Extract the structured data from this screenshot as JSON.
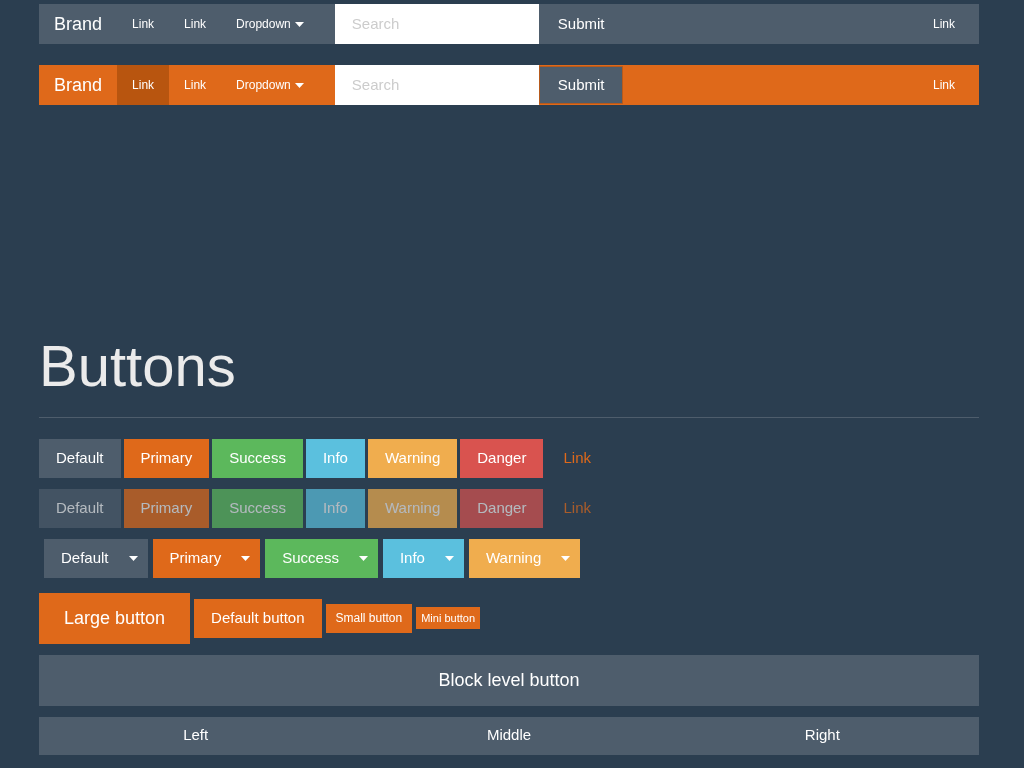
{
  "navbars": [
    {
      "kind": "default",
      "brand": "Brand",
      "links": [
        {
          "label": "Link",
          "kind": "link"
        },
        {
          "label": "Link",
          "kind": "link"
        },
        {
          "label": "Dropdown",
          "kind": "dropdown"
        }
      ],
      "search": {
        "placeholder": "Search"
      },
      "submit": "Submit",
      "right_link": "Link"
    },
    {
      "kind": "inverse",
      "brand": "Brand",
      "links": [
        {
          "label": "Link",
          "selected": true,
          "kind": "link"
        },
        {
          "label": "Link",
          "selected": false,
          "kind": "link"
        },
        {
          "label": "Dropdown",
          "selected": false,
          "kind": "dropdown"
        }
      ],
      "search": {
        "placeholder": "Search"
      },
      "submit": "Submit",
      "right_link": "Link"
    }
  ],
  "heading": "Buttons",
  "button_rows": [
    {
      "disabled": false,
      "buttons": [
        {
          "label": "Default",
          "kind": "default"
        },
        {
          "label": "Primary",
          "kind": "primary"
        },
        {
          "label": "Success",
          "kind": "success"
        },
        {
          "label": "Info",
          "kind": "info"
        },
        {
          "label": "Warning",
          "kind": "warning"
        },
        {
          "label": "Danger",
          "kind": "danger"
        },
        {
          "label": "Link",
          "kind": "link"
        }
      ]
    },
    {
      "disabled": true,
      "buttons": [
        {
          "label": "Default",
          "kind": "default"
        },
        {
          "label": "Primary",
          "kind": "primary"
        },
        {
          "label": "Success",
          "kind": "success"
        },
        {
          "label": "Info",
          "kind": "info"
        },
        {
          "label": "Warning",
          "kind": "warning"
        },
        {
          "label": "Danger",
          "kind": "danger"
        },
        {
          "label": "Link",
          "kind": "link"
        }
      ]
    }
  ],
  "split_buttons": [
    {
      "label": "Default",
      "kind": "default"
    },
    {
      "label": "Primary",
      "kind": "primary"
    },
    {
      "label": "Success",
      "kind": "success"
    },
    {
      "label": "Info",
      "kind": "info"
    },
    {
      "label": "Warning",
      "kind": "warning"
    }
  ],
  "size_buttons": [
    {
      "label": "Large button",
      "kind": "large"
    },
    {
      "label": "Default button",
      "kind": "default"
    },
    {
      "label": "Small button",
      "kind": "small"
    },
    {
      "label": "Mini button",
      "kind": "mini"
    }
  ],
  "block_button": "Block level button",
  "justified_group": [
    "Left",
    "Middle",
    "Right"
  ]
}
